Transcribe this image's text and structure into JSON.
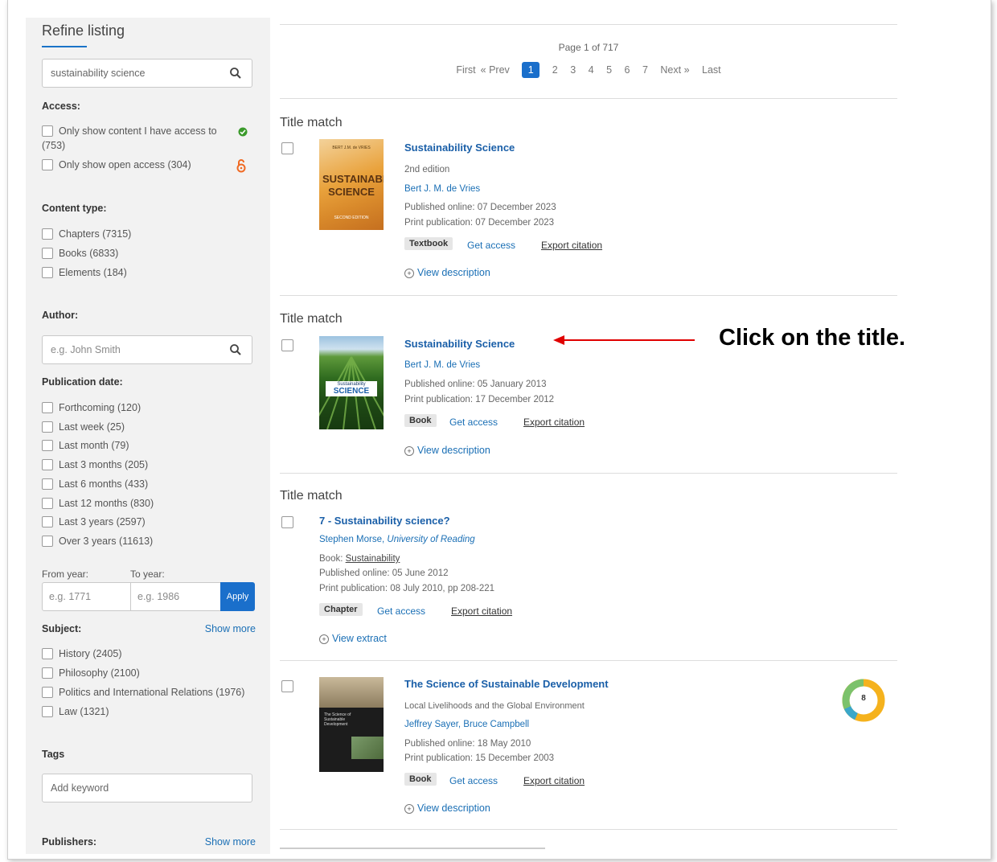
{
  "sidebar": {
    "title": "Refine listing",
    "search_value": "sustainability science",
    "access_heading": "Access:",
    "access_items": [
      "Only show content I have access to",
      "(753)",
      "Only show open access (304)"
    ],
    "content_type_heading": "Content type:",
    "content_types": [
      "Chapters (7315)",
      "Books (6833)",
      "Elements (184)"
    ],
    "author_heading": "Author:",
    "author_placeholder": "e.g. John Smith",
    "pubdate_heading": "Publication date:",
    "pubdates": [
      "Forthcoming (120)",
      "Last week (25)",
      "Last month (79)",
      "Last 3 months (205)",
      "Last 6 months (433)",
      "Last 12 months (830)",
      "Last 3 years (2597)",
      "Over 3 years (11613)"
    ],
    "from_year_label": "From year:",
    "to_year_label": "To year:",
    "from_year_placeholder": "e.g. 1771",
    "to_year_placeholder": "e.g. 1986",
    "apply_label": "Apply",
    "subject_heading": "Subject:",
    "show_more": "Show more",
    "subjects": [
      "History (2405)",
      "Philosophy (2100)",
      "Politics and International Relations (1976)",
      "Law (1321)"
    ],
    "tags_heading": "Tags",
    "tags_placeholder": "Add keyword",
    "publishers_heading": "Publishers:"
  },
  "pagination": {
    "page_of": "Page 1 of 717",
    "first": "First",
    "prev": "« Prev",
    "pages": [
      "1",
      "2",
      "3",
      "4",
      "5",
      "6",
      "7"
    ],
    "next": "Next »",
    "last": "Last"
  },
  "results": [
    {
      "match": "Title match",
      "title": "Sustainability Science",
      "edition": "2nd edition",
      "authors": "Bert J. M. de Vries",
      "online": "Published online: 07 December 2023",
      "print": "Print publication: 07 December 2023",
      "type": "Textbook",
      "get_access": "Get access",
      "export": "Export citation",
      "view": "View description",
      "cover_title": "SUSTAINABILITY SCIENCE",
      "cover_author": "BERT J.M. de VRIES",
      "cover_edition": "SECOND EDITION"
    },
    {
      "match": "Title match",
      "title": "Sustainability Science",
      "authors": "Bert J. M. de Vries",
      "online": "Published online: 05 January 2013",
      "print": "Print publication: 17 December 2012",
      "type": "Book",
      "get_access": "Get access",
      "export": "Export citation",
      "view": "View description",
      "cover_line1": "Sustainability",
      "cover_line2": "SCIENCE"
    },
    {
      "match": "Title match",
      "title": "7 - Sustainability science?",
      "authors": "Stephen Morse,",
      "affiliation": "University of Reading",
      "book_prefix": "Book:",
      "book_name": "Sustainability",
      "online": "Published online: 05 June 2012",
      "print": "Print publication: 08 July 2010, pp 208-221",
      "type": "Chapter",
      "get_access": "Get access",
      "export": "Export citation",
      "view": "View extract"
    },
    {
      "title": "The Science of Sustainable Development",
      "subtitle": "Local Livelihoods and the Global Environment",
      "authors": "Jeffrey Sayer, Bruce Campbell",
      "online": "Published online: 18 May 2010",
      "print": "Print publication: 15 December 2003",
      "type": "Book",
      "get_access": "Get access",
      "export": "Export citation",
      "view": "View description",
      "altmetric_score": "8",
      "cover_text": "The Science of Sustainable Development"
    }
  ],
  "annotation": "Click on the title.",
  "colors": {
    "link": "#1a5fa8",
    "accent": "#1a6fcb",
    "annotation_arrow": "#e00000"
  }
}
